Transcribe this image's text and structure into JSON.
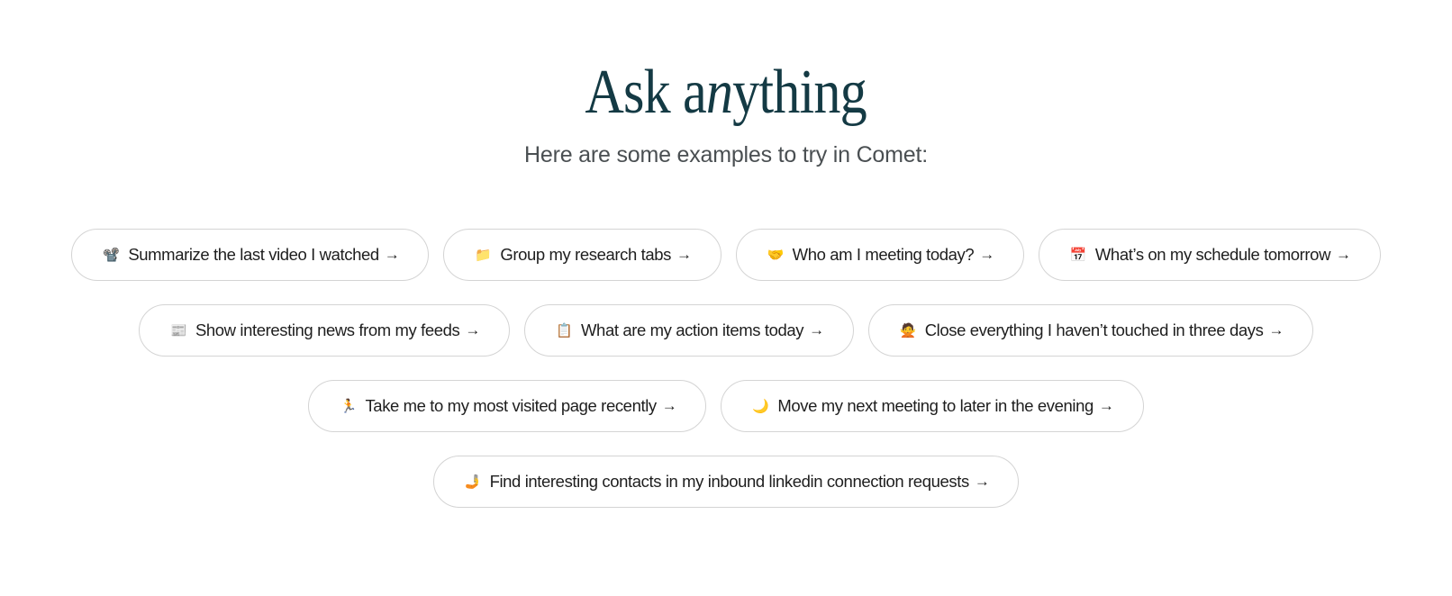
{
  "hero": {
    "title_part1": "Ask a",
    "title_italic": "n",
    "title_part2": "ything",
    "subtitle": "Here are some examples to try in Comet:"
  },
  "arrow": "→",
  "chips": {
    "summarize_video": {
      "emoji": "📽️",
      "label": "Summarize the last video I watched"
    },
    "group_tabs": {
      "emoji": "📁",
      "label": "Group my research tabs"
    },
    "meeting_today": {
      "emoji": "🤝",
      "label": "Who am I meeting today?"
    },
    "schedule_tomorrow": {
      "emoji": "📅",
      "label": "What’s on my schedule tomorrow"
    },
    "news_feeds": {
      "emoji": "📰",
      "label": "Show interesting news from my feeds"
    },
    "action_items": {
      "emoji": "📋",
      "label": "What are my action items today"
    },
    "close_tabs": {
      "emoji": "🙅",
      "label": "Close everything I haven’t touched in three days"
    },
    "most_visited": {
      "emoji": "🏃",
      "label": "Take me to my most visited page recently"
    },
    "move_meeting": {
      "emoji": "🌙",
      "label": "Move my next meeting to later in the evening"
    },
    "linkedin_contacts": {
      "emoji": "🤳",
      "label": "Find interesting contacts in my inbound linkedin connection requests"
    }
  }
}
